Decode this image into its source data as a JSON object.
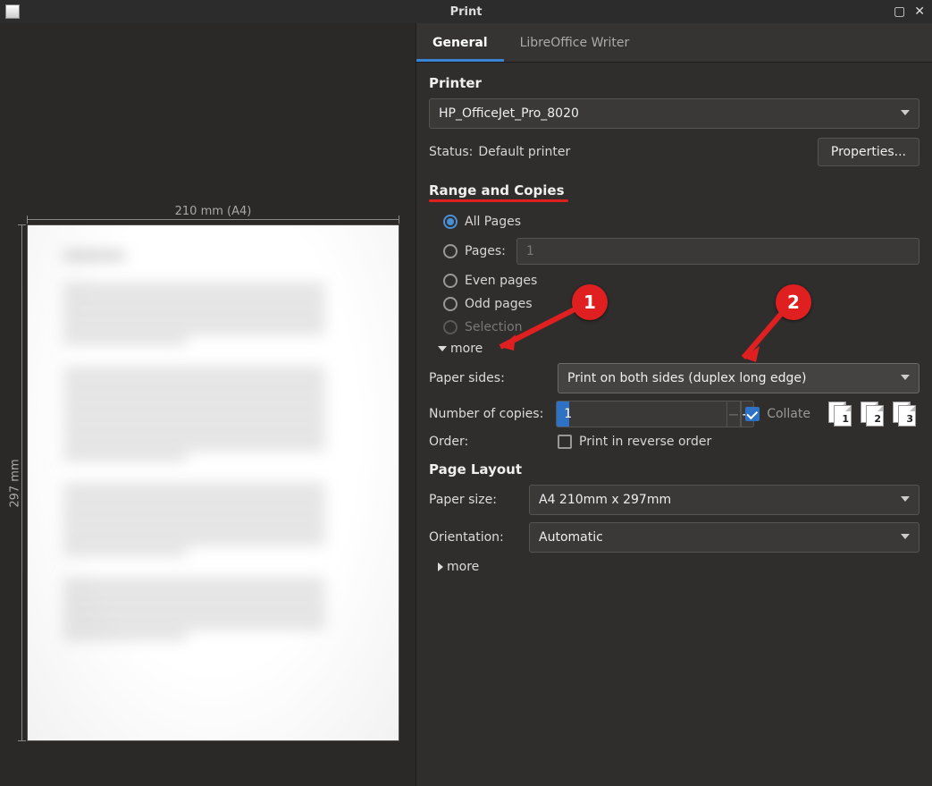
{
  "window": {
    "title": "Print"
  },
  "tabs": {
    "general": "General",
    "writer": "LibreOffice Writer"
  },
  "preview": {
    "width_label": "210 mm (A4)",
    "height_label": "297 mm"
  },
  "printer": {
    "section": "Printer",
    "selected": "HP_OfficeJet_Pro_8020",
    "status_label": "Status:",
    "status_value": "Default printer",
    "properties_btn": "Properties..."
  },
  "range": {
    "section": "Range and Copies",
    "all_pages": "All Pages",
    "pages_label": "Pages:",
    "pages_placeholder": "1",
    "even": "Even pages",
    "odd": "Odd pages",
    "selection": "Selection",
    "more": "more",
    "paper_sides_label": "Paper sides:",
    "paper_sides_value": "Print on both sides (duplex long edge)",
    "copies_label": "Number of copies:",
    "copies_value": "1",
    "collate": "Collate",
    "order_label": "Order:",
    "reverse": "Print in reverse order"
  },
  "layout": {
    "section": "Page Layout",
    "paper_size_label": "Paper size:",
    "paper_size_value": "A4 210mm x 297mm",
    "orientation_label": "Orientation:",
    "orientation_value": "Automatic",
    "more": "more"
  },
  "annotations": {
    "a1": "1",
    "a2": "2"
  },
  "collate_icons": [
    "1",
    "2",
    "3"
  ]
}
